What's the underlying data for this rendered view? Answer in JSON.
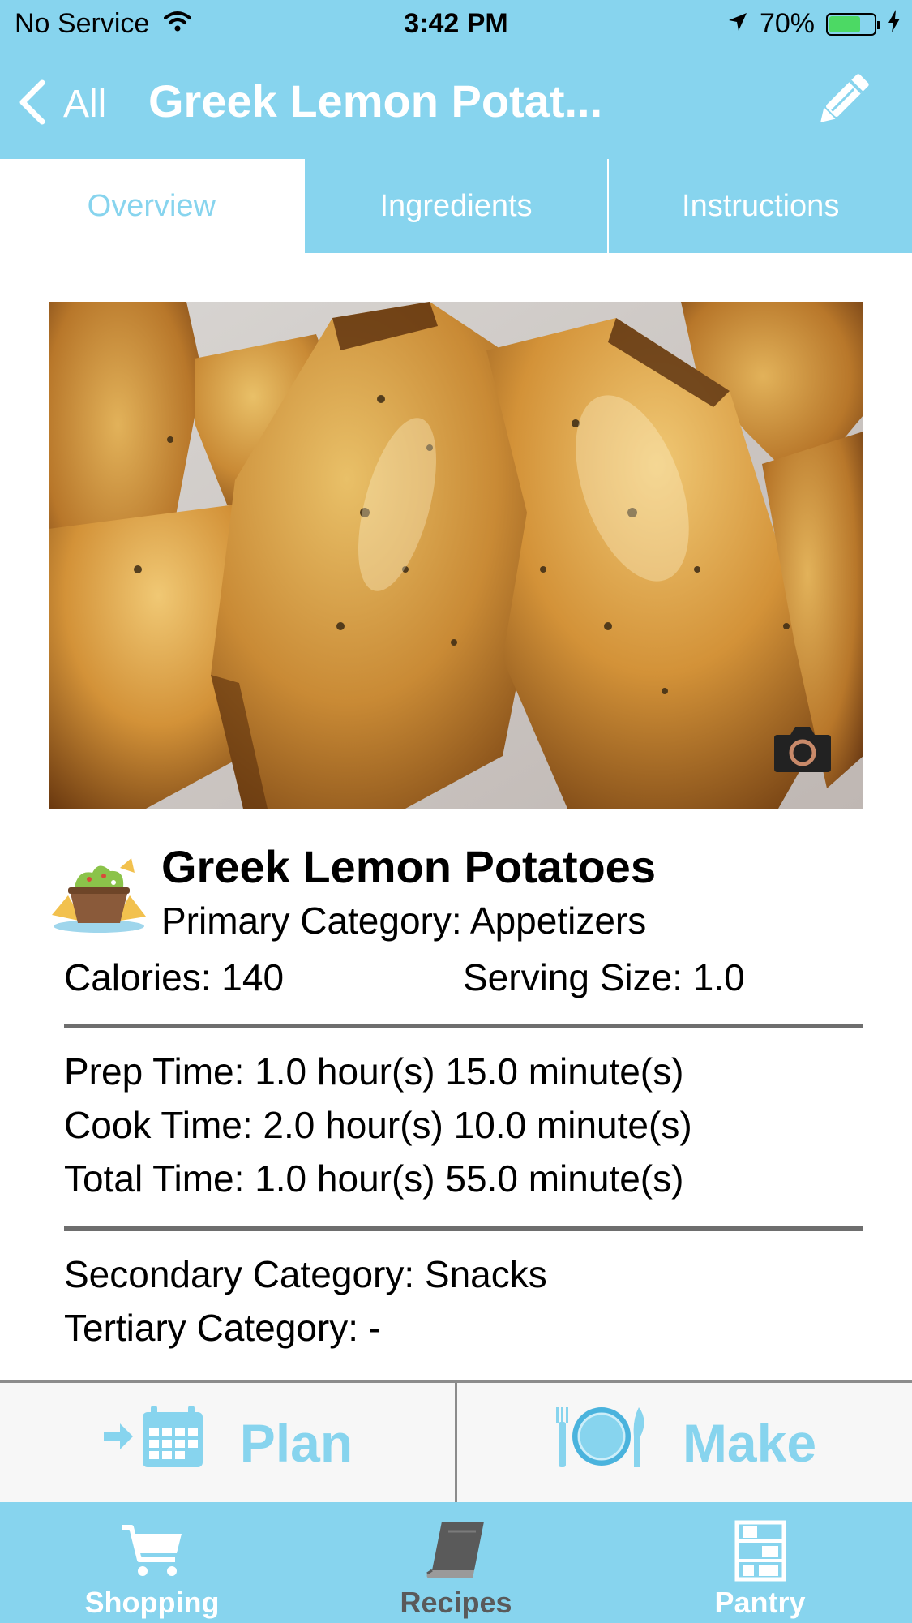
{
  "status_bar": {
    "carrier": "No Service",
    "time": "3:42 PM",
    "battery_percent": "70%",
    "battery_level": 0.7,
    "icons": [
      "wifi-icon",
      "location-arrow-icon",
      "battery-icon",
      "charging-bolt-icon"
    ]
  },
  "nav": {
    "back_label": "All",
    "title": "Greek Lemon Potat...",
    "edit_icon": "pencil-icon"
  },
  "tabs": [
    {
      "label": "Overview",
      "active": true
    },
    {
      "label": "Ingredients",
      "active": false
    },
    {
      "label": "Instructions",
      "active": false
    }
  ],
  "recipe": {
    "photo_description_icon": "camera-icon",
    "category_icon": "guacamole-chips-icon",
    "name": "Greek Lemon Potatoes",
    "primary_category": "Primary Category: Appetizers",
    "calories": "Calories: 140",
    "serving_size": "Serving Size: 1.0",
    "prep_time": "Prep Time: 1.0 hour(s) 15.0 minute(s)",
    "cook_time": "Cook Time: 2.0 hour(s) 10.0 minute(s)",
    "total_time": "Total Time: 1.0 hour(s) 55.0 minute(s)",
    "secondary_category": "Secondary Category: Snacks",
    "tertiary_category": "Tertiary Category: -"
  },
  "actions": {
    "plan_label": "Plan",
    "make_label": "Make"
  },
  "tab_bar": [
    {
      "label": "Shopping",
      "icon": "cart-icon",
      "active": false
    },
    {
      "label": "Recipes",
      "icon": "book-icon",
      "active": true
    },
    {
      "label": "Pantry",
      "icon": "pantry-shelf-icon",
      "active": false
    }
  ],
  "colors": {
    "accent": "#87d4ee",
    "active_tab_bar_label": "#5a5a5a",
    "divider": "#6e6e6e"
  }
}
